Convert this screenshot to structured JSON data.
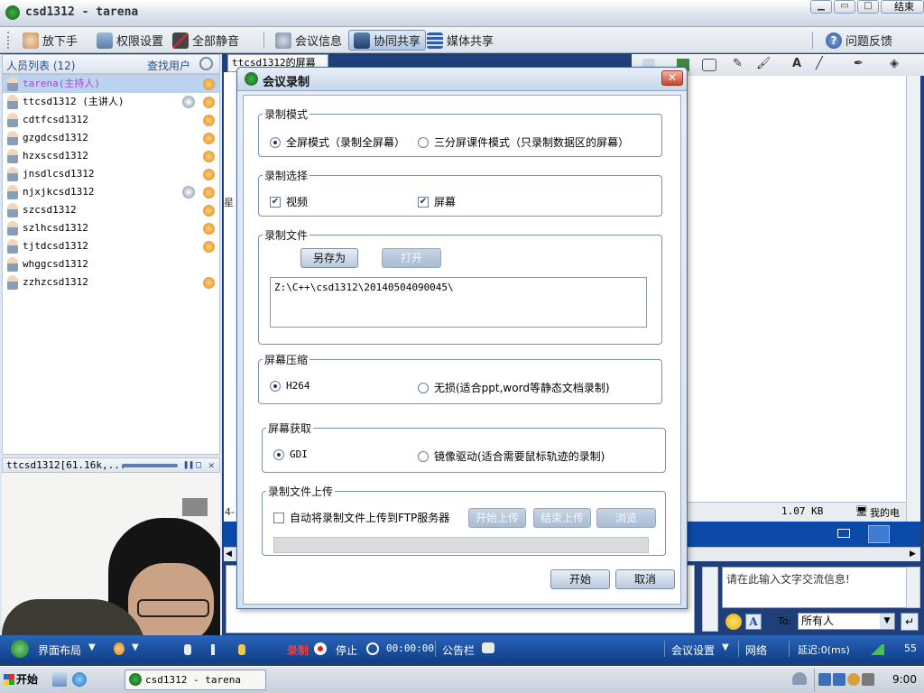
{
  "window": {
    "title": "csd1312 - tarena",
    "corner_text": "结束"
  },
  "toolbar": {
    "items": [
      {
        "label": "放下手",
        "icon": "hand-icon"
      },
      {
        "label": "权限设置",
        "icon": "permission-icon"
      },
      {
        "label": "全部静音",
        "icon": "mute-all-icon"
      },
      {
        "label": "会议信息",
        "icon": "meeting-info-icon"
      },
      {
        "label": "协同共享",
        "icon": "co-share-icon"
      },
      {
        "label": "媒体共享",
        "icon": "media-share-icon"
      }
    ],
    "feedback": "问题反馈"
  },
  "participants": {
    "header": "人员列表 (12)",
    "find": "查找用户",
    "items": [
      {
        "name": "tarena(主持人)",
        "host": true
      },
      {
        "name": "ttcsd1312 (主讲人)",
        "camera": true
      },
      {
        "name": "cdtfcsd1312"
      },
      {
        "name": "gzgdcsd1312"
      },
      {
        "name": "hzxscsd1312"
      },
      {
        "name": "jnsdlcsd1312"
      },
      {
        "name": "njxjkcsd1312",
        "camera": true
      },
      {
        "name": "szcsd1312"
      },
      {
        "name": "szlhcsd1312"
      },
      {
        "name": "tjtdcsd1312"
      },
      {
        "name": "whggcsd1312",
        "no_mic": true
      },
      {
        "name": "zzhzcsd1312"
      }
    ]
  },
  "video": {
    "label": "ttcsd1312[61.16k,..."
  },
  "share_tab": {
    "label": "ttcsd1312的屏幕",
    "side_char": "星",
    "side_char2": "4-"
  },
  "file_info": {
    "size": "1.07 KB",
    "computer": "我的电脑"
  },
  "dialog": {
    "title": "会议录制",
    "mode": {
      "legend": "录制模式",
      "options": [
        "全屏模式（录制全屏幕）",
        "三分屏课件模式（只录制数据区的屏幕）"
      ],
      "selected": 0
    },
    "select": {
      "legend": "录制选择",
      "video": "视频",
      "screen": "屏幕",
      "video_checked": true,
      "screen_checked": true
    },
    "file": {
      "legend": "录制文件",
      "save_as": "另存为",
      "open": "打开",
      "path": "Z:\\C++\\csd1312\\20140504090045\\"
    },
    "compress": {
      "legend": "屏幕压缩",
      "options": [
        "H264",
        "无损(适合ppt,word等静态文档录制)"
      ],
      "selected": 0
    },
    "capture": {
      "legend": "屏幕获取",
      "options": [
        "GDI",
        "镜像驱动(适合需要鼠标轨迹的录制)"
      ],
      "selected": 0
    },
    "upload": {
      "legend": "录制文件上传",
      "auto_label": "自动将录制文件上传到FTP服务器",
      "auto_checked": false,
      "start": "开始上传",
      "stop": "结束上传",
      "browse": "浏览",
      "progress": 0
    },
    "ok": "开始",
    "cancel": "取消"
  },
  "chat": {
    "placeholder": "请在此输入文字交流信息!",
    "to_label": "To:",
    "to_value": "所有人"
  },
  "statusbar": {
    "layout": "界面布局",
    "record": "录制",
    "stop": "停止",
    "time": "00:00:00",
    "bulletin": "公告栏",
    "meeting_settings": "会议设置",
    "network": "网络",
    "delay": "延迟:0(ms)",
    "signal": "55"
  },
  "taskbar": {
    "start": "开始",
    "task": "csd1312 - tarena",
    "clock": "9:00"
  },
  "colors": {
    "host_name": "#a24ad6",
    "titlebar_blue": "#0b4aa8",
    "status_bg": "#1a55a8"
  }
}
